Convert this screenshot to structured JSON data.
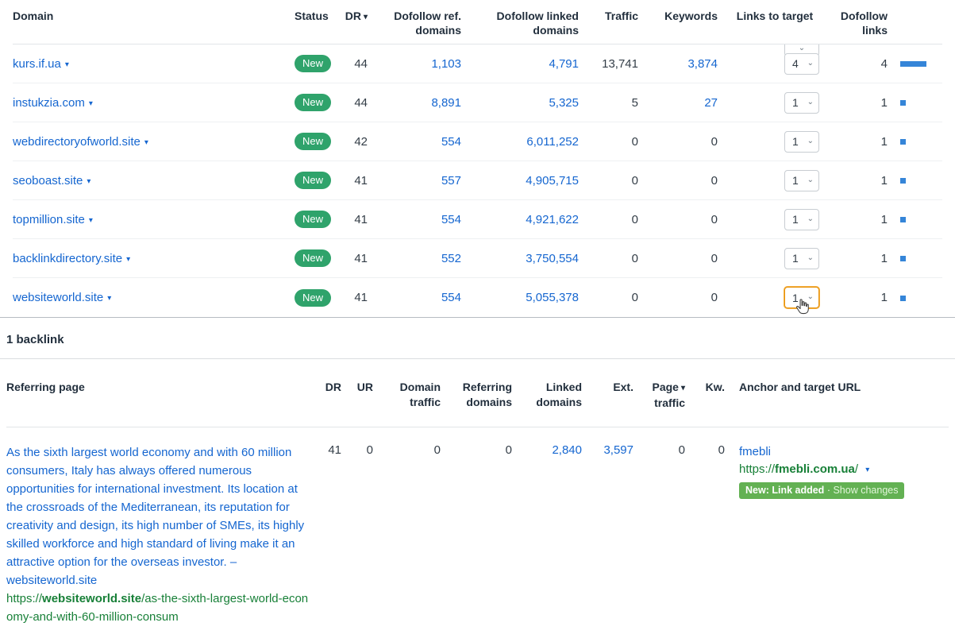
{
  "colors": {
    "link_blue": "#1566d0",
    "url_green": "#188038",
    "status_badge_green": "#2fa36b",
    "change_badge_green": "#63b153",
    "bar_blue": "#3585d8",
    "focus_orange": "#e8930c"
  },
  "icons": {
    "dropdown_caret": "▾",
    "sort_desc": "▾",
    "select_chevron": "⌄"
  },
  "domains_table": {
    "headers": {
      "domain": "Domain",
      "status": "Status",
      "dr": "DR",
      "dofollow_ref": "Dofollow ref. domains",
      "dofollow_linked": "Dofollow linked domains",
      "traffic": "Traffic",
      "keywords": "Keywords",
      "links_to_target": "Links to target",
      "dofollow_links": "Dofollow links"
    },
    "rows": [
      {
        "domain": "kurs.if.ua",
        "status": "New",
        "dr": "44",
        "dofollow_ref_domains": "1,103",
        "dofollow_linked_domains": "4,791",
        "traffic": "13,741",
        "keywords": "3,874",
        "links_to_target": "4",
        "dofollow_links": "4"
      },
      {
        "domain": "instukzia.com",
        "status": "New",
        "dr": "44",
        "dofollow_ref_domains": "8,891",
        "dofollow_linked_domains": "5,325",
        "traffic": "5",
        "keywords": "27",
        "links_to_target": "1",
        "dofollow_links": "1"
      },
      {
        "domain": "webdirectoryofworld.site",
        "status": "New",
        "dr": "42",
        "dofollow_ref_domains": "554",
        "dofollow_linked_domains": "6,011,252",
        "traffic": "0",
        "keywords": "0",
        "links_to_target": "1",
        "dofollow_links": "1"
      },
      {
        "domain": "seoboast.site",
        "status": "New",
        "dr": "41",
        "dofollow_ref_domains": "557",
        "dofollow_linked_domains": "4,905,715",
        "traffic": "0",
        "keywords": "0",
        "links_to_target": "1",
        "dofollow_links": "1"
      },
      {
        "domain": "topmillion.site",
        "status": "New",
        "dr": "41",
        "dofollow_ref_domains": "554",
        "dofollow_linked_domains": "4,921,622",
        "traffic": "0",
        "keywords": "0",
        "links_to_target": "1",
        "dofollow_links": "1"
      },
      {
        "domain": "backlinkdirectory.site",
        "status": "New",
        "dr": "41",
        "dofollow_ref_domains": "552",
        "dofollow_linked_domains": "3,750,554",
        "traffic": "0",
        "keywords": "0",
        "links_to_target": "1",
        "dofollow_links": "1"
      },
      {
        "domain": "websiteworld.site",
        "status": "New",
        "dr": "41",
        "dofollow_ref_domains": "554",
        "dofollow_linked_domains": "5,055,378",
        "traffic": "0",
        "keywords": "0",
        "links_to_target": "1",
        "dofollow_links": "1"
      }
    ]
  },
  "section_title": "1 backlink",
  "backlinks_table": {
    "headers": {
      "referring_page": "Referring page",
      "dr": "DR",
      "ur": "UR",
      "domain_traffic": "Domain traffic",
      "referring_domains": "Referring domains",
      "linked_domains": "Linked domains",
      "ext": "Ext.",
      "page_line1": "Page",
      "page_line2": "traffic",
      "kw": "Kw.",
      "anchor": "Anchor and target URL"
    },
    "row": {
      "referring_text": "As the sixth largest world economy and with 60 million consumers, Italy has always offered numerous opportunities for international investment. Its location at the crossroads of the Mediterranean, its reputation for creativity and design, its high number of SMEs, its highly skilled workforce and high standard of living make it an attractive option for the overseas investor. – websiteworld.site",
      "referring_url_scheme": "https://",
      "referring_url_domain": "websiteworld.site",
      "referring_url_path": "/as-the-sixth-largest-world-economy-and-with-60-million-consum",
      "dr": "41",
      "ur": "0",
      "domain_traffic": "0",
      "referring_domains": "0",
      "linked_domains": "2,840",
      "ext": "3,597",
      "page_traffic": "0",
      "kw": "0",
      "anchor_text": "fmebli",
      "target_url_scheme": "https://",
      "target_url_domain": "fmebli.com.ua",
      "target_url_path": "/",
      "change_badge": "New: Link added",
      "change_separator": "·",
      "change_link": "Show changes"
    }
  }
}
